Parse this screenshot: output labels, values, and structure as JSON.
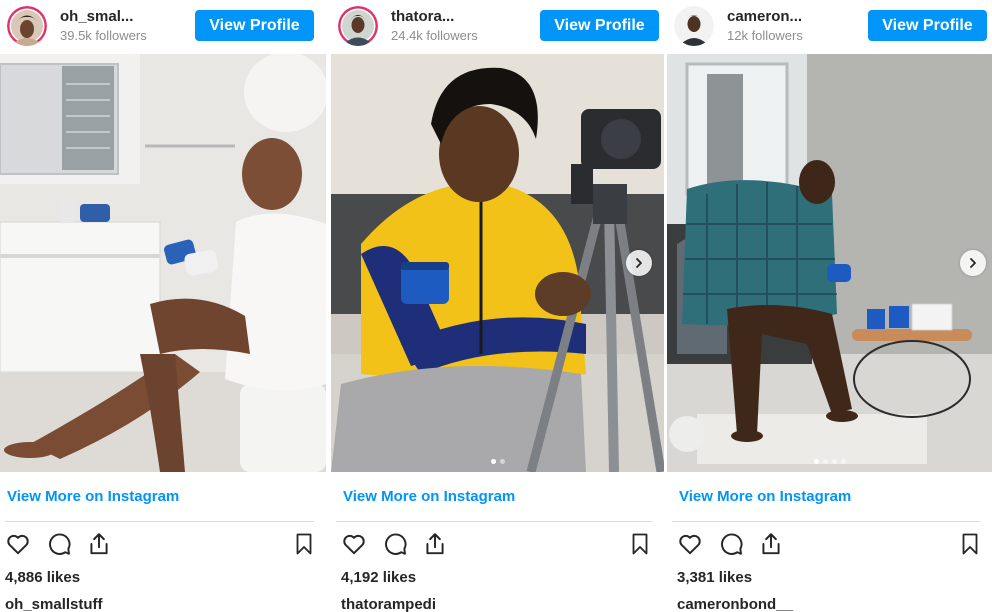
{
  "posts": [
    {
      "username": "oh_smal...",
      "followers": "39.5k followers",
      "view_profile_label": "View Profile",
      "view_more_label": "View More on Instagram",
      "likes": "4,886 likes",
      "caption_user": "oh_smallstuff",
      "has_next_arrow": false,
      "dots": 0
    },
    {
      "username": "thatora...",
      "followers": "24.4k followers",
      "view_profile_label": "View Profile",
      "view_more_label": "View More on Instagram",
      "likes": "4,192 likes",
      "caption_user": "thatorampedi",
      "has_next_arrow": true,
      "dots": 2
    },
    {
      "username": "cameron...",
      "followers": "12k followers",
      "view_profile_label": "View Profile",
      "view_more_label": "View More on Instagram",
      "likes": "3,381 likes",
      "caption_user": "cameronbond__",
      "has_next_arrow": true,
      "dots": 4
    }
  ],
  "icons": [
    "heart-icon",
    "comment-icon",
    "share-icon",
    "bookmark-icon",
    "chevron-right-icon"
  ],
  "colors": {
    "accent": "#0095f6",
    "text": "#262626",
    "muted": "#8e8e8e",
    "divider": "#dbdbdb"
  }
}
